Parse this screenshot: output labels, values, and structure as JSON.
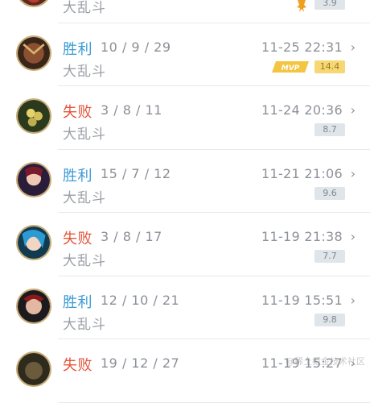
{
  "rows": [
    {
      "result": "",
      "kda": "",
      "mode": "大乱斗",
      "time": "",
      "score": "3.9"
    },
    {
      "result": "胜利",
      "kda": "10 / 9 / 29",
      "mode": "大乱斗",
      "time": "11-25 22:31",
      "score": "14.4",
      "badge": "MVP"
    },
    {
      "result": "失败",
      "kda": "3 / 8 / 11",
      "mode": "大乱斗",
      "time": "11-24 20:36",
      "score": "8.7"
    },
    {
      "result": "胜利",
      "kda": "15 / 7 / 12",
      "mode": "大乱斗",
      "time": "11-21 21:06",
      "score": "9.6"
    },
    {
      "result": "失败",
      "kda": "3 / 8 / 17",
      "mode": "大乱斗",
      "time": "11-19 21:38",
      "score": "7.7"
    },
    {
      "result": "胜利",
      "kda": "12 / 10 / 21",
      "mode": "大乱斗",
      "time": "11-19 15:51",
      "score": "9.8"
    },
    {
      "result": "失败",
      "kda": "19 / 12 / 27",
      "mode": "大乱斗",
      "time": "11-19 15:27",
      "score": ""
    }
  ],
  "chevron": "›",
  "watermark": "@稀土掘金技术社区",
  "colors": {
    "win": "#3d9bd5",
    "loss": "#e4543a",
    "gold": "#f7d774",
    "frame": "#c9ab73"
  },
  "icons": {
    "chevron": "chevron-right-icon",
    "mvp": "mvp-badge-icon",
    "award": "award-icon"
  }
}
